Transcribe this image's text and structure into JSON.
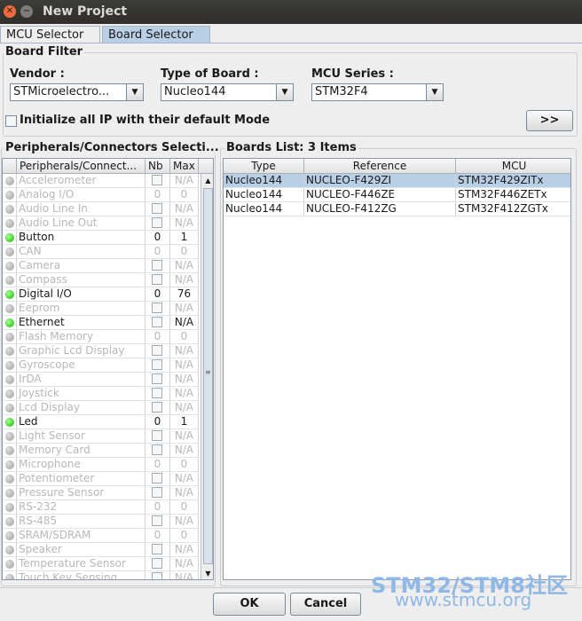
{
  "window": {
    "title": "New Project"
  },
  "tabs": [
    {
      "label": "MCU Selector"
    },
    {
      "label": "Board Selector"
    }
  ],
  "board_filter": {
    "title": "Board Filter",
    "vendor_label": "Vendor :",
    "vendor_value": "STMicroelectro...",
    "type_label": "Type of Board :",
    "type_value": "Nucleo144",
    "series_label": "MCU Series :",
    "series_value": "STM32F4",
    "init_ip_label": "Initialize all IP with their default Mode",
    "more_button": ">>"
  },
  "peripherals": {
    "title": "Peripherals/Connectors Selecti...",
    "headers": [
      "Peripherals/Connect...",
      "Nb",
      "Max"
    ],
    "rows": [
      {
        "name": "Accelerometer",
        "nb": "",
        "max": "N/A",
        "enabled": false
      },
      {
        "name": "Analog I/O",
        "nb": "0",
        "max": "0",
        "enabled": false
      },
      {
        "name": "Audio Line In",
        "nb": "",
        "max": "N/A",
        "enabled": false
      },
      {
        "name": "Audio Line Out",
        "nb": "",
        "max": "N/A",
        "enabled": false
      },
      {
        "name": "Button",
        "nb": "0",
        "max": "1",
        "enabled": true
      },
      {
        "name": "CAN",
        "nb": "0",
        "max": "0",
        "enabled": false
      },
      {
        "name": "Camera",
        "nb": "",
        "max": "N/A",
        "enabled": false
      },
      {
        "name": "Compass",
        "nb": "",
        "max": "N/A",
        "enabled": false
      },
      {
        "name": "Digital I/O",
        "nb": "0",
        "max": "76",
        "enabled": true
      },
      {
        "name": "Eeprom",
        "nb": "",
        "max": "N/A",
        "enabled": false
      },
      {
        "name": "Ethernet",
        "nb": "",
        "max": "N/A",
        "enabled": true
      },
      {
        "name": "Flash Memory",
        "nb": "0",
        "max": "0",
        "enabled": false
      },
      {
        "name": "Graphic Lcd Display",
        "nb": "",
        "max": "N/A",
        "enabled": false
      },
      {
        "name": "Gyroscope",
        "nb": "",
        "max": "N/A",
        "enabled": false
      },
      {
        "name": "IrDA",
        "nb": "",
        "max": "N/A",
        "enabled": false
      },
      {
        "name": "Joystick",
        "nb": "",
        "max": "N/A",
        "enabled": false
      },
      {
        "name": "Lcd Display",
        "nb": "",
        "max": "N/A",
        "enabled": false
      },
      {
        "name": "Led",
        "nb": "0",
        "max": "1",
        "enabled": true
      },
      {
        "name": "Light Sensor",
        "nb": "",
        "max": "N/A",
        "enabled": false
      },
      {
        "name": "Memory Card",
        "nb": "",
        "max": "N/A",
        "enabled": false
      },
      {
        "name": "Microphone",
        "nb": "0",
        "max": "0",
        "enabled": false
      },
      {
        "name": "Potentiometer",
        "nb": "",
        "max": "N/A",
        "enabled": false
      },
      {
        "name": "Pressure Sensor",
        "nb": "",
        "max": "N/A",
        "enabled": false
      },
      {
        "name": "RS-232",
        "nb": "0",
        "max": "0",
        "enabled": false
      },
      {
        "name": "RS-485",
        "nb": "",
        "max": "N/A",
        "enabled": false
      },
      {
        "name": "SRAM/SDRAM",
        "nb": "0",
        "max": "0",
        "enabled": false
      },
      {
        "name": "Speaker",
        "nb": "",
        "max": "N/A",
        "enabled": false
      },
      {
        "name": "Temperature Sensor",
        "nb": "",
        "max": "N/A",
        "enabled": false
      },
      {
        "name": "Touch Key Sensing",
        "nb": "",
        "max": "N/A",
        "enabled": false
      }
    ]
  },
  "boards": {
    "title": "Boards List: 3 Items",
    "headers": [
      "Type",
      "Reference",
      "MCU"
    ],
    "rows": [
      {
        "type": "Nucleo144",
        "reference": "NUCLEO-F429ZI",
        "mcu": "STM32F429ZITx",
        "selected": true
      },
      {
        "type": "Nucleo144",
        "reference": "NUCLEO-F446ZE",
        "mcu": "STM32F446ZETx",
        "selected": false
      },
      {
        "type": "Nucleo144",
        "reference": "NUCLEO-F412ZG",
        "mcu": "STM32F412ZGTx",
        "selected": false
      }
    ]
  },
  "footer": {
    "ok_label": "OK",
    "cancel_label": "Cancel"
  },
  "watermark": {
    "line1": "STM32/STM8社区",
    "line2": "www.stmcu.org"
  }
}
